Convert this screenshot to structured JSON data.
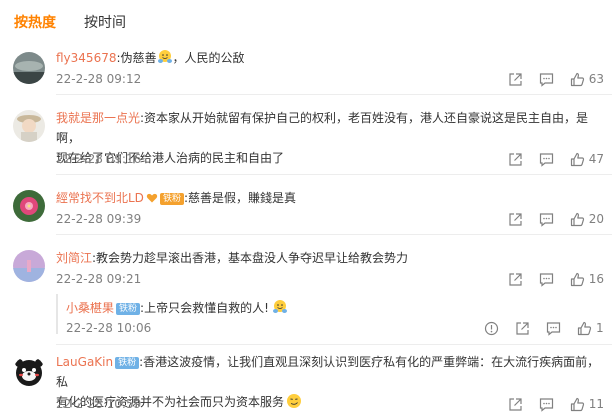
{
  "tabs": [
    "按热度",
    "按时间"
  ],
  "colors": {
    "accent": "#ff8200",
    "username": "#eb7350",
    "meta": "#808080",
    "badge_fans": "#6fb1e6",
    "badge_super": "#f4a12e"
  },
  "comments": [
    {
      "user": "fly345678",
      "text": ":伪慈善",
      "text_after": "，人民的公敌",
      "time": "22-2-28 09:12",
      "likes": "63",
      "emoji": "hug-emoji"
    },
    {
      "user": "我就是那一点光",
      "text": ":资本家从开始就留有保护自己的权利，老百姓没有，港人还自豪说这是民主自由，是啊，",
      "text_line2": "现在给了它们不给港人治病的民主和自由了",
      "time": "22-2-28 09:16",
      "likes": "47"
    },
    {
      "user": "經常找不到北LD",
      "badge": "铁粉",
      "text": ":慈善是假，賺錢是真",
      "time": "22-2-28 09:39",
      "likes": "20"
    },
    {
      "user": "刘简江",
      "text": ":教会势力趁早滚出香港，基本盘没人争夺迟早让给教会势力",
      "time": "22-2-28 09:21",
      "likes": "16"
    },
    {
      "user": "LauGaKin",
      "badge": "铁粉",
      "text": ":香港这波疫情，让我们直观且深刻认识到医疗私有化的严重弊端：在大流行疾病面前，私",
      "text_line2": "有化的医疗资源并不为社会而只为资本服务",
      "time": "22-2-28 10:59",
      "likes": "11",
      "emoji": "smirk-emoji"
    }
  ],
  "reply": {
    "user": "小桑椹果",
    "badge": "铁粉",
    "text": ":上帝只会救懂自救的人!",
    "time": "22-2-28 10:06",
    "likes": "1",
    "emoji": "hug-emoji"
  }
}
